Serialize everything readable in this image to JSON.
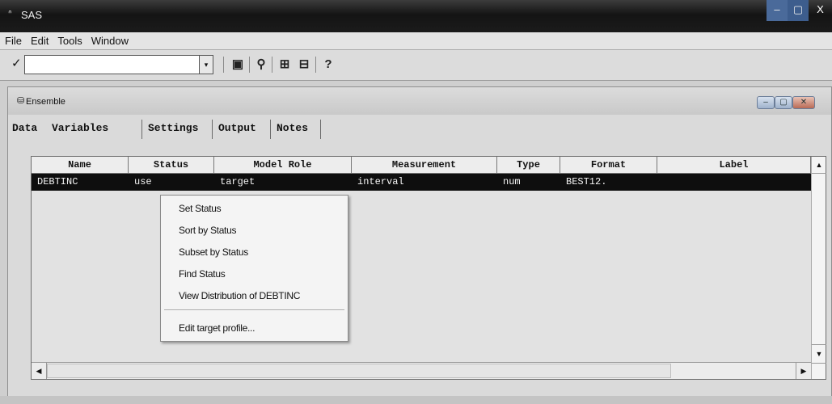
{
  "app": {
    "title": "SAS",
    "window_controls": {
      "minimize": "–",
      "maximize": "▢",
      "close": "X"
    }
  },
  "menubar": {
    "items": [
      "File",
      "Edit",
      "Tools",
      "Window"
    ]
  },
  "toolbar": {
    "command_check": "✓",
    "command_value": "",
    "dropdown_glyph": "▾",
    "buttons": [
      {
        "name": "save-icon",
        "glyph": "▣"
      },
      {
        "name": "run-icon",
        "glyph": "⚲"
      },
      {
        "name": "explorer-icon",
        "glyph": "⊞"
      },
      {
        "name": "results-icon",
        "glyph": "⊟"
      },
      {
        "name": "help-icon",
        "glyph": "?"
      }
    ]
  },
  "child_window": {
    "title": "Ensemble",
    "controls": {
      "minimize": "–",
      "maximize": "▢",
      "close": "✕"
    }
  },
  "tabs": [
    "Data",
    "Variables",
    "Settings",
    "Output",
    "Notes"
  ],
  "table": {
    "columns": [
      "Name",
      "Status",
      "Model Role",
      "Measurement",
      "Type",
      "Format",
      "Label"
    ],
    "rows": [
      [
        "DEBTINC",
        "use",
        "target",
        "interval",
        "num",
        "BEST12.",
        ""
      ]
    ]
  },
  "context_menu": {
    "items": [
      "Set Status",
      "Sort by Status",
      "Subset by Status",
      "Find Status",
      "View Distribution of DEBTINC",
      "Edit target profile..."
    ]
  },
  "colors": {
    "selected_row_bg": "#0e0e0e",
    "selected_row_fg": "#f5f5f5",
    "title_bar": "#141414"
  }
}
